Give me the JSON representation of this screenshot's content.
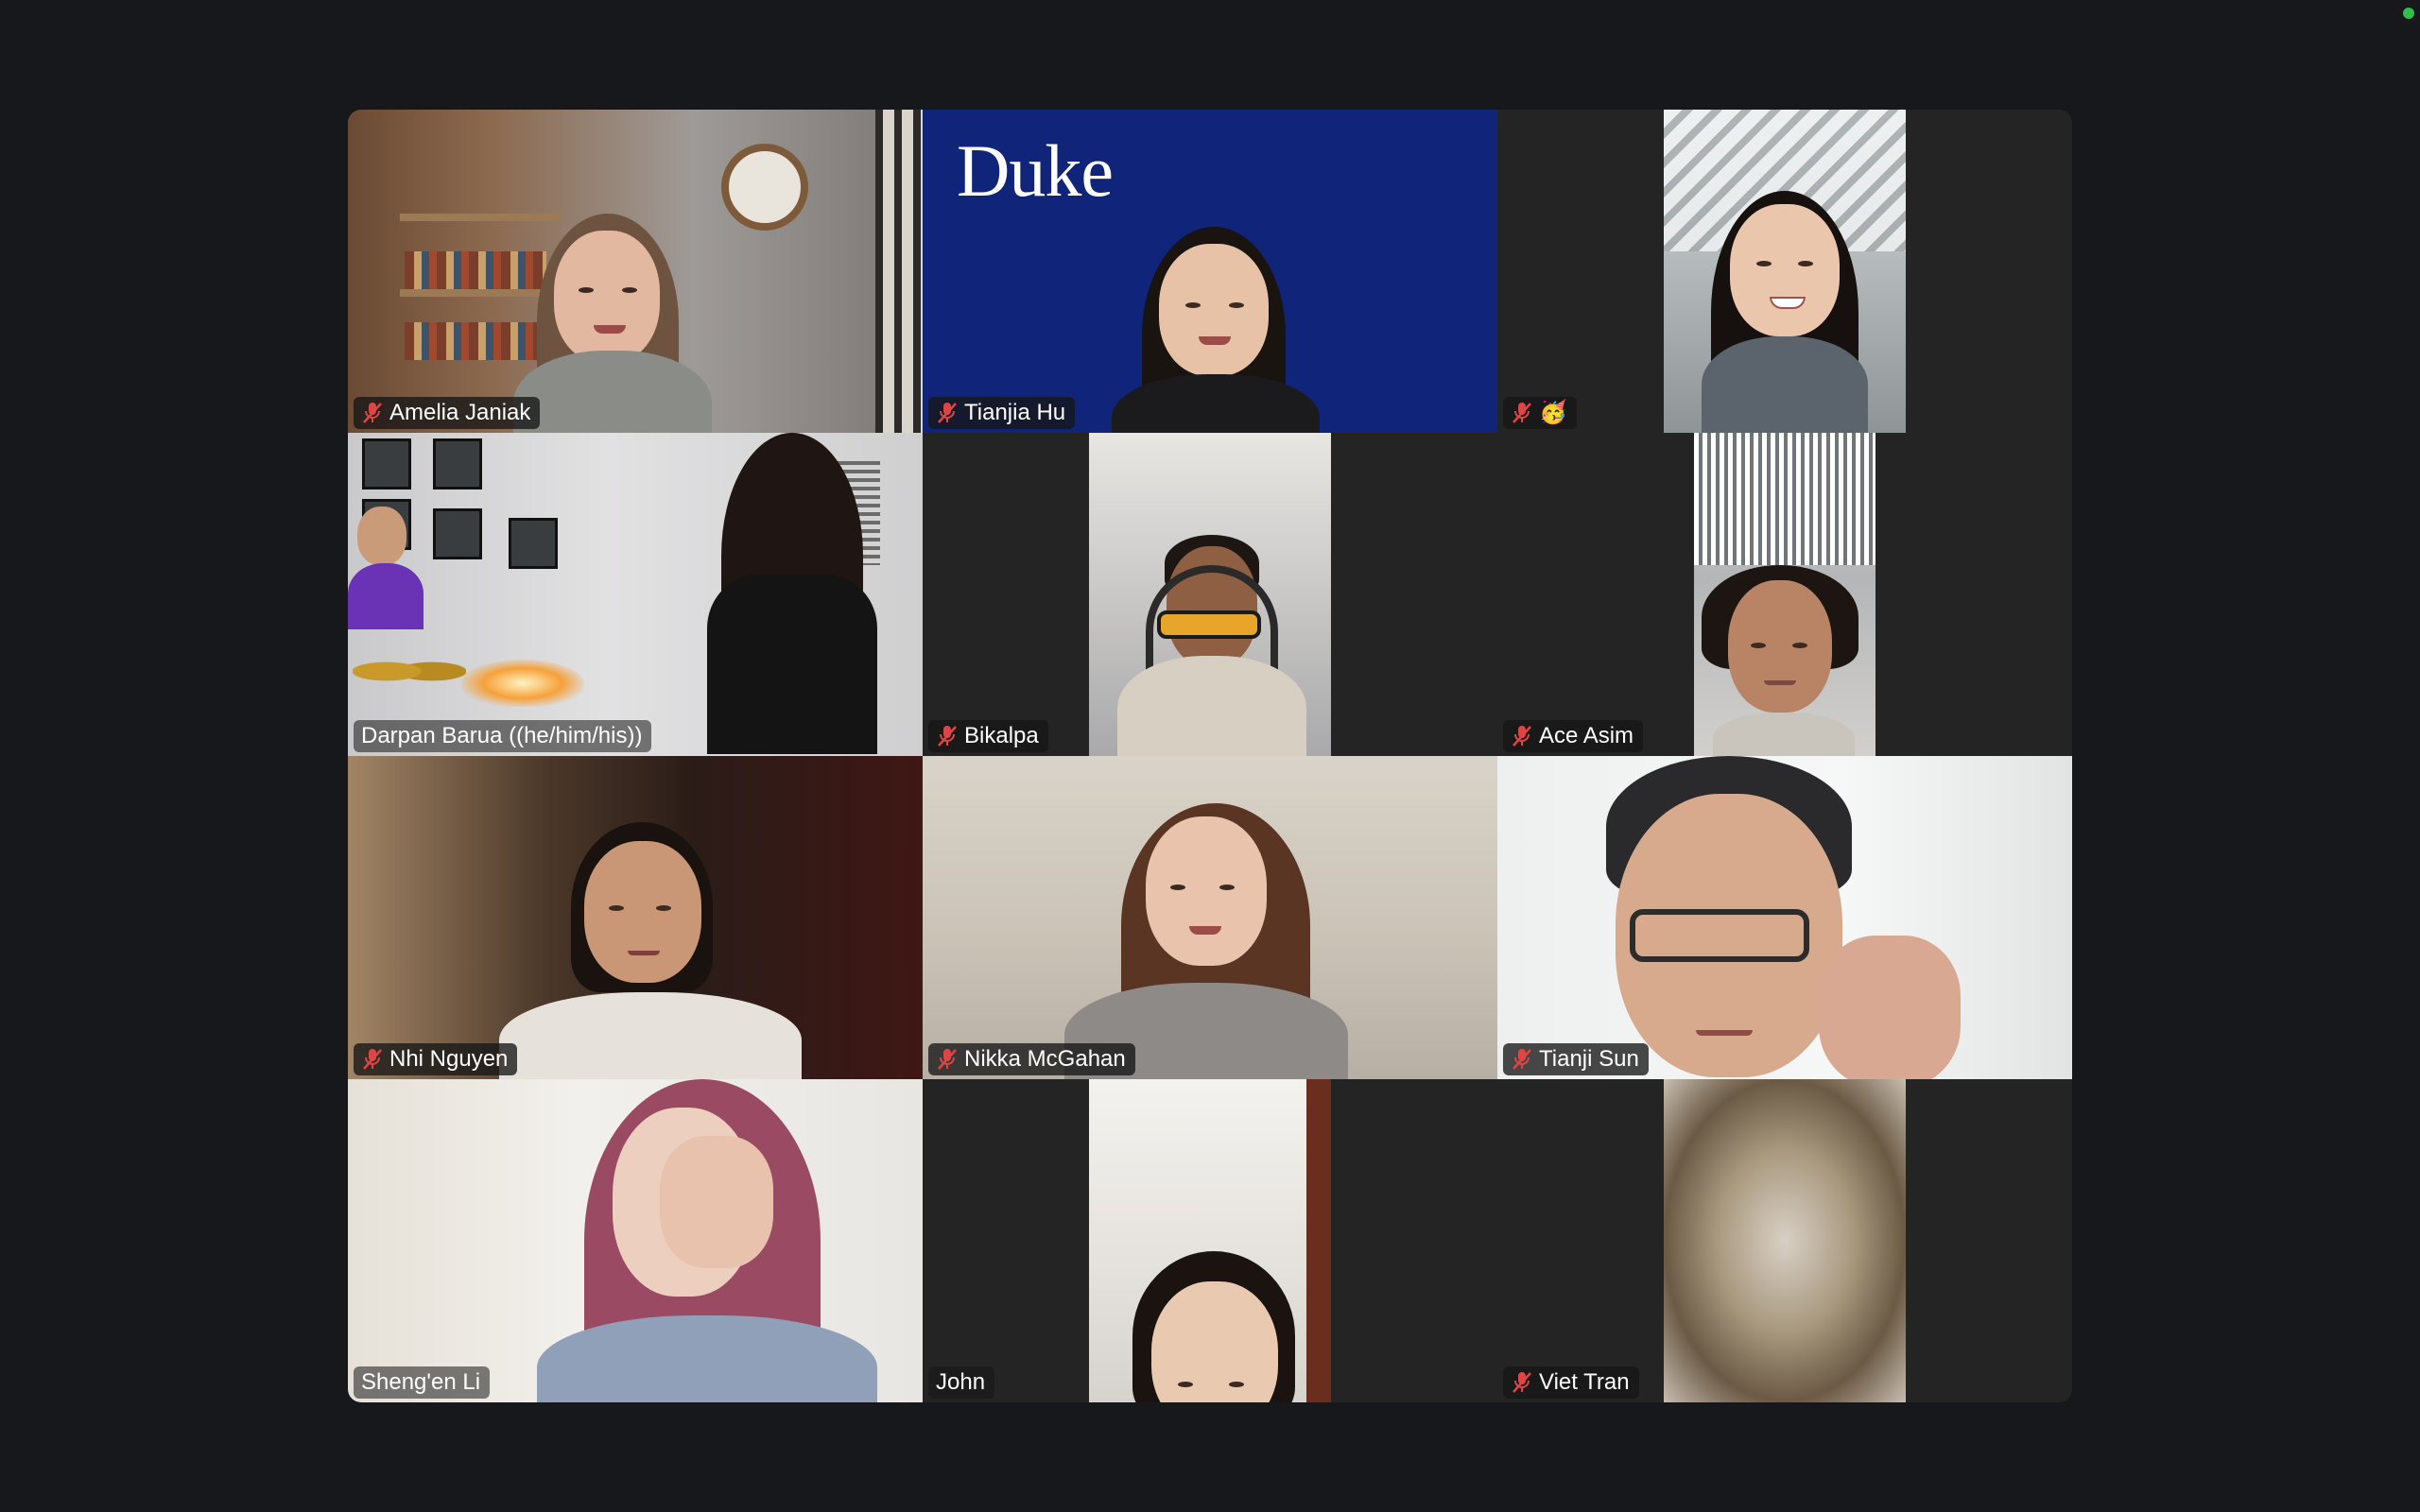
{
  "window": {
    "status_color": "#2fbf4a",
    "active_speaker_color": "#3ddc52"
  },
  "participants": [
    {
      "name": "Amelia Janiak",
      "muted": true
    },
    {
      "name": "Tianjia Hu",
      "muted": true,
      "background_text": "Duke"
    },
    {
      "name": "🥳",
      "muted": true
    },
    {
      "name": "Darpan Barua ((he/him/his))",
      "muted": false,
      "active_speaker": true
    },
    {
      "name": "Bikalpa",
      "muted": true
    },
    {
      "name": "Ace Asim",
      "muted": true
    },
    {
      "name": "Nhi Nguyen",
      "muted": true
    },
    {
      "name": "Nikka McGahan",
      "muted": true
    },
    {
      "name": "Tianji Sun",
      "muted": true
    },
    {
      "name": "Sheng'en Li",
      "muted": false
    },
    {
      "name": "John",
      "muted": false
    },
    {
      "name": "Viet Tran",
      "muted": true
    }
  ],
  "icons": {
    "mute": "microphone-muted-icon"
  }
}
